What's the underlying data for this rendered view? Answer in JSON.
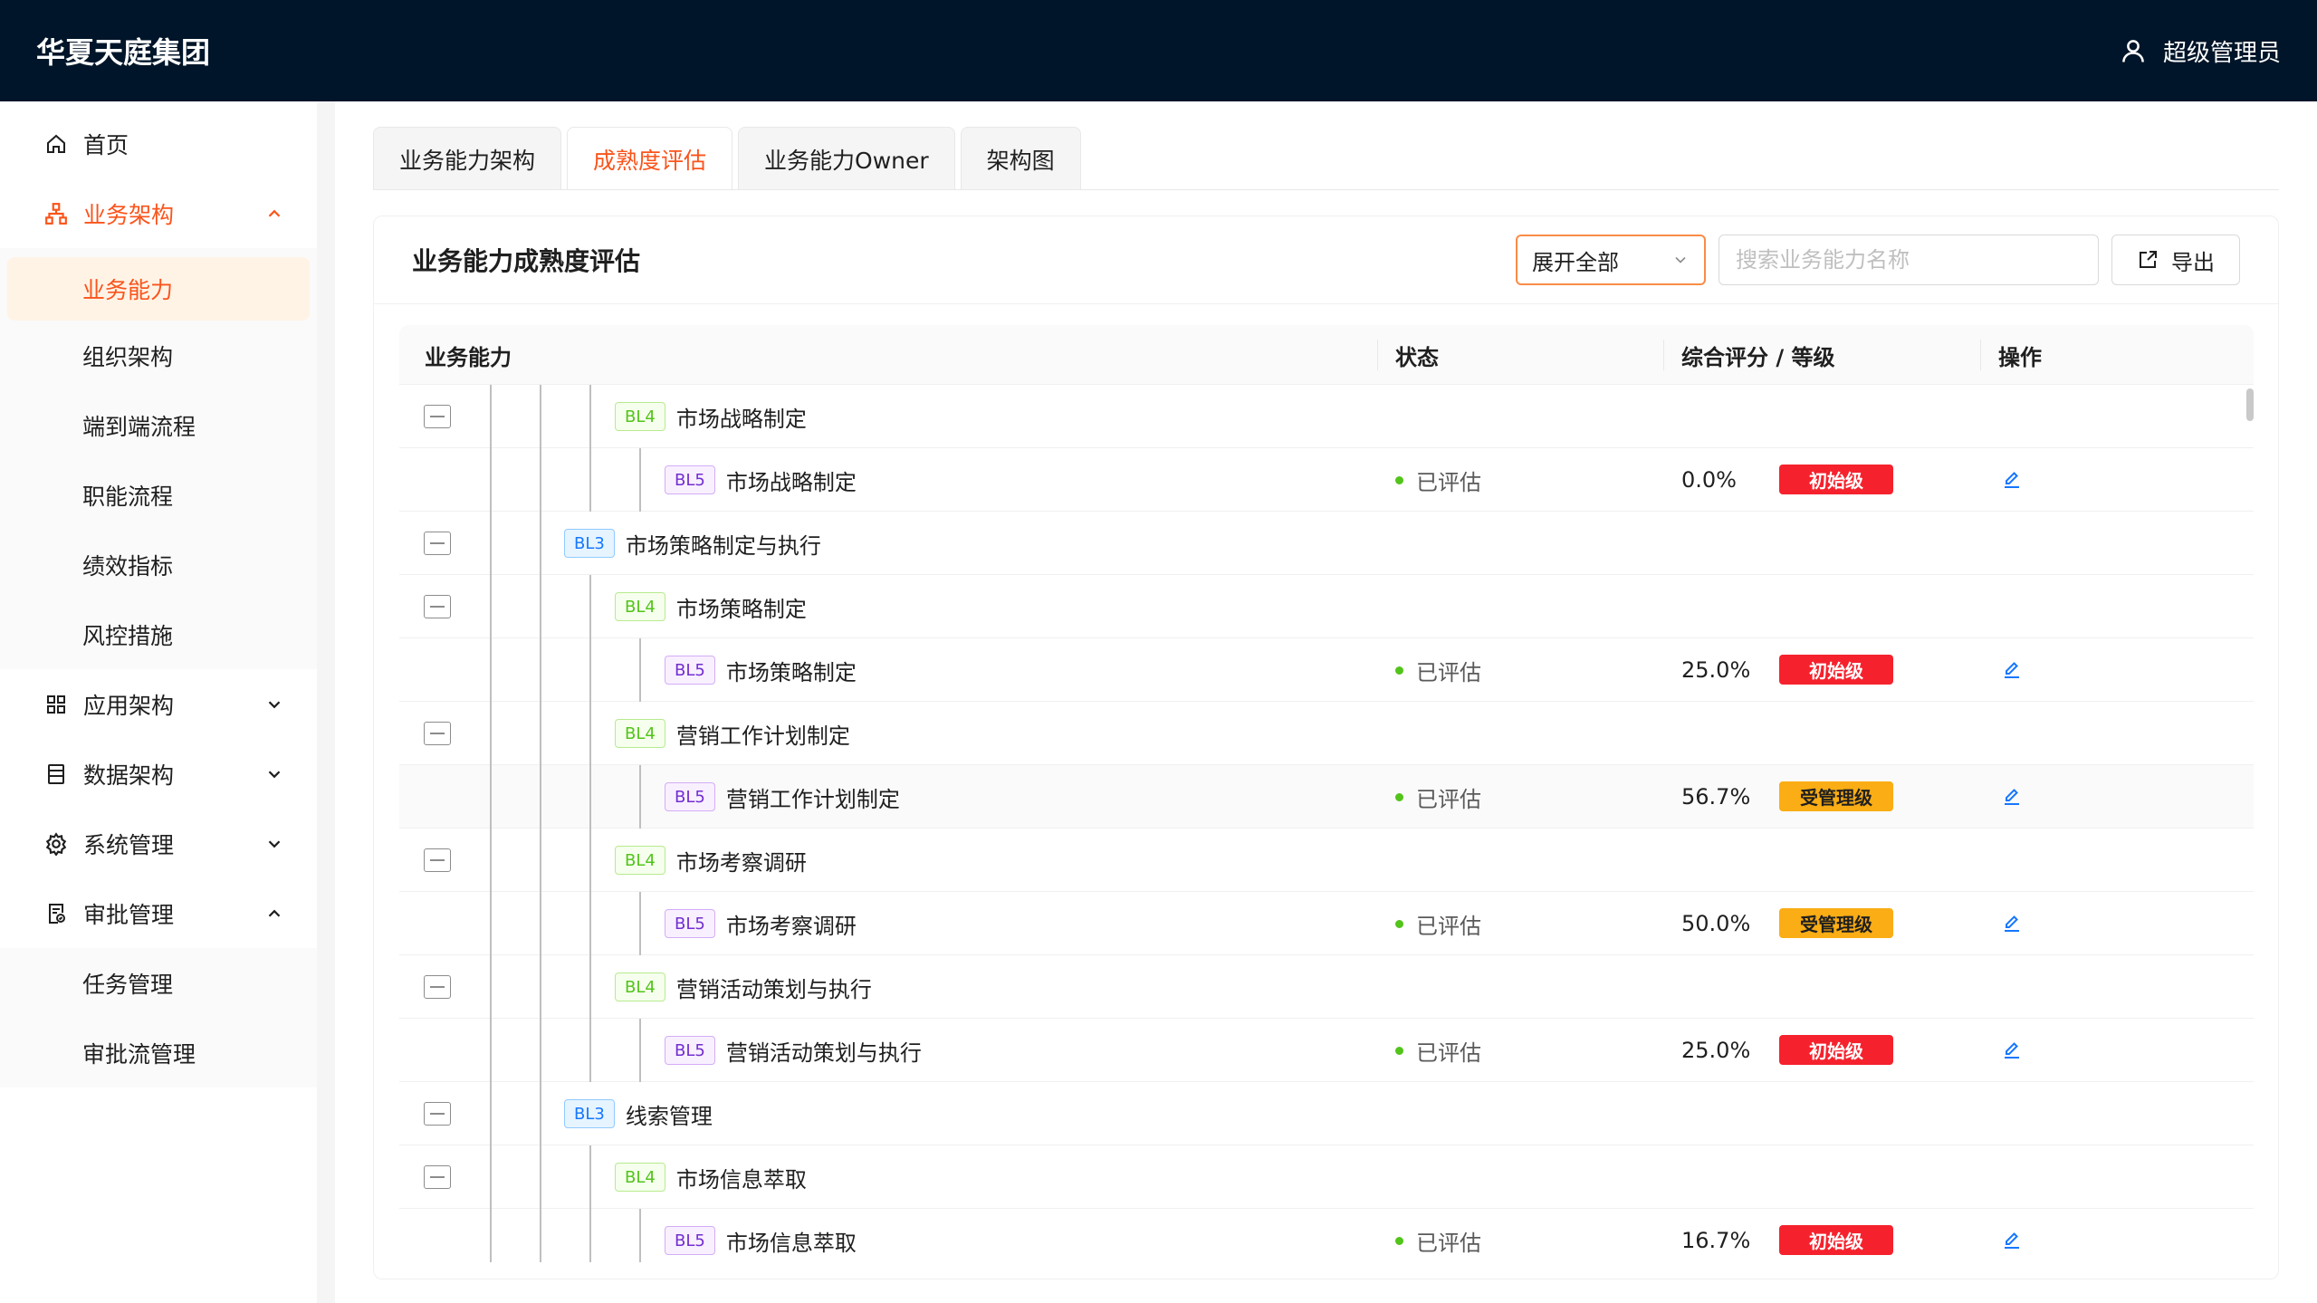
{
  "app": {
    "title": "华夏天庭集团",
    "user": "超级管理员"
  },
  "sidebar": {
    "home": "首页",
    "biz_arch": {
      "label": "业务架构",
      "items": [
        "业务能力",
        "组织架构",
        "端到端流程",
        "职能流程",
        "绩效指标",
        "风控措施"
      ]
    },
    "app_arch": "应用架构",
    "data_arch": "数据架构",
    "sys_mgmt": "系统管理",
    "approval": {
      "label": "审批管理",
      "items": [
        "任务管理",
        "审批流管理"
      ]
    }
  },
  "tabs": [
    "业务能力架构",
    "成熟度评估",
    "业务能力Owner",
    "架构图"
  ],
  "active_tab": "成熟度评估",
  "card": {
    "title": "业务能力成熟度评估",
    "expand_select": "展开全部",
    "search_placeholder": "搜索业务能力名称",
    "export_label": "导出"
  },
  "table": {
    "columns": [
      "业务能力",
      "状态",
      "综合评分 / 等级",
      "操作"
    ],
    "rows": [
      {
        "level": "BL4",
        "name": "市场战略制定",
        "status": "",
        "score": "",
        "grade": ""
      },
      {
        "level": "BL5",
        "name": "市场战略制定",
        "status": "已评估",
        "score": "0.0%",
        "grade": "初始级"
      },
      {
        "level": "BL3",
        "name": "市场策略制定与执行",
        "status": "",
        "score": "",
        "grade": ""
      },
      {
        "level": "BL4",
        "name": "市场策略制定",
        "status": "",
        "score": "",
        "grade": ""
      },
      {
        "level": "BL5",
        "name": "市场策略制定",
        "status": "已评估",
        "score": "25.0%",
        "grade": "初始级"
      },
      {
        "level": "BL4",
        "name": "营销工作计划制定",
        "status": "",
        "score": "",
        "grade": ""
      },
      {
        "level": "BL5",
        "name": "营销工作计划制定",
        "status": "已评估",
        "score": "56.7%",
        "grade": "受管理级"
      },
      {
        "level": "BL4",
        "name": "市场考察调研",
        "status": "",
        "score": "",
        "grade": ""
      },
      {
        "level": "BL5",
        "name": "市场考察调研",
        "status": "已评估",
        "score": "50.0%",
        "grade": "受管理级"
      },
      {
        "level": "BL4",
        "name": "营销活动策划与执行",
        "status": "",
        "score": "",
        "grade": ""
      },
      {
        "level": "BL5",
        "name": "营销活动策划与执行",
        "status": "已评估",
        "score": "25.0%",
        "grade": "初始级"
      },
      {
        "level": "BL3",
        "name": "线索管理",
        "status": "",
        "score": "",
        "grade": ""
      },
      {
        "level": "BL4",
        "name": "市场信息萃取",
        "status": "",
        "score": "",
        "grade": ""
      },
      {
        "level": "BL5",
        "name": "市场信息萃取",
        "status": "已评估",
        "score": "16.7%",
        "grade": "初始级"
      }
    ]
  },
  "colors": {
    "accent": "#fa541c",
    "header_bg": "#001529",
    "grade_initial": "#f5222d",
    "grade_managed": "#faad14",
    "status_dot": "#52c41a"
  }
}
